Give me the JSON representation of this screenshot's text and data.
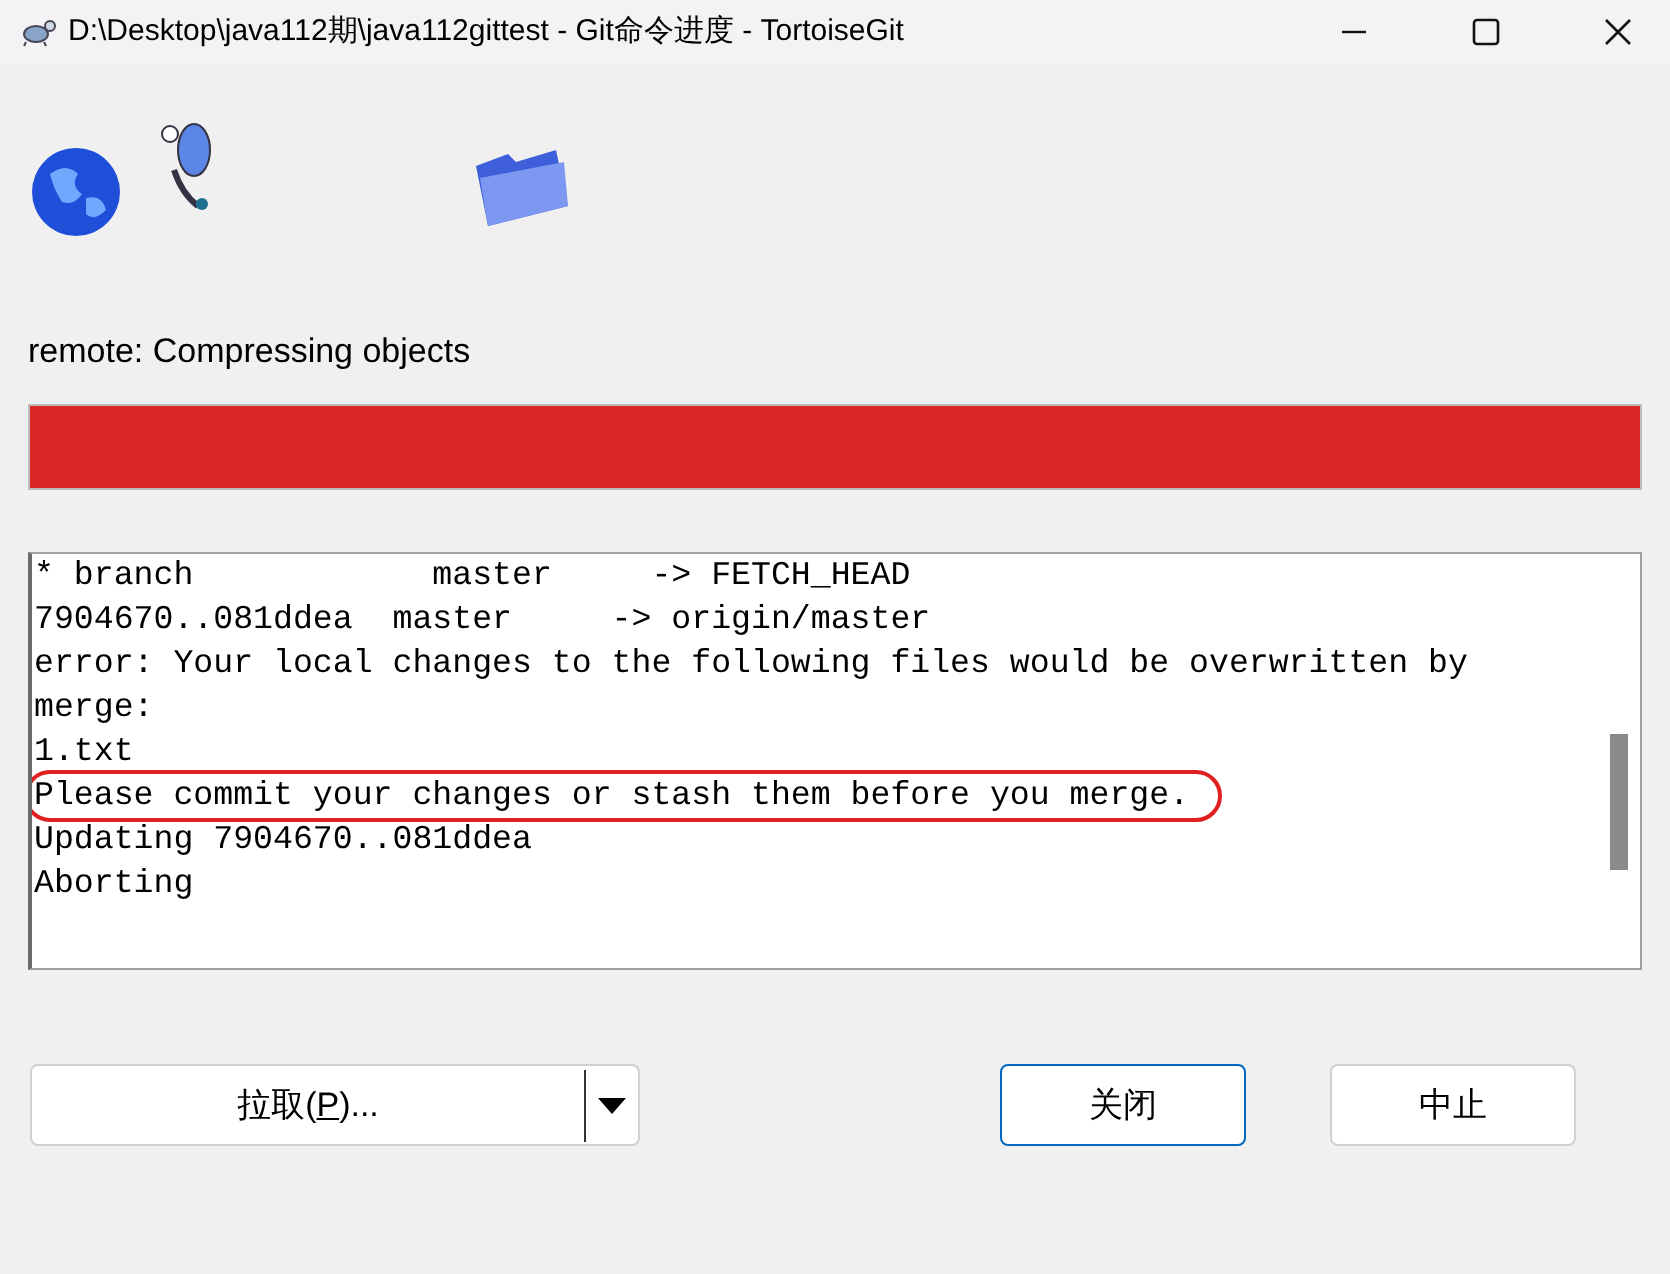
{
  "window": {
    "title": "D:\\Desktop\\java112期\\java112gittest - Git命令进度 - TortoiseGit"
  },
  "status": "remote: Compressing objects",
  "progress": {
    "level": 1,
    "color": "#dc2626"
  },
  "log": [
    {
      "text": "* branch            master     -> FETCH_HEAD",
      "highlighted": false
    },
    {
      "text": "7904670..081ddea  master     -> origin/master",
      "highlighted": false
    },
    {
      "text": "error: Your local changes to the following files would be overwritten by",
      "highlighted": false
    },
    {
      "text": "merge:",
      "highlighted": false
    },
    {
      "text": "1.txt",
      "highlighted": false
    },
    {
      "text": "Please commit your changes or stash them before you merge.",
      "highlighted": true
    },
    {
      "text": "Updating 7904670..081ddea",
      "highlighted": false
    },
    {
      "text": "Aborting",
      "highlighted": false
    }
  ],
  "buttons": [
    {
      "kind": "split",
      "label": "拉取(",
      "mnemonic": "P",
      "label_rest": ")...",
      "focused": false
    },
    {
      "kind": "plain",
      "label": "关闭",
      "focused": true
    },
    {
      "kind": "plain",
      "label": "中止",
      "focused": false
    }
  ]
}
